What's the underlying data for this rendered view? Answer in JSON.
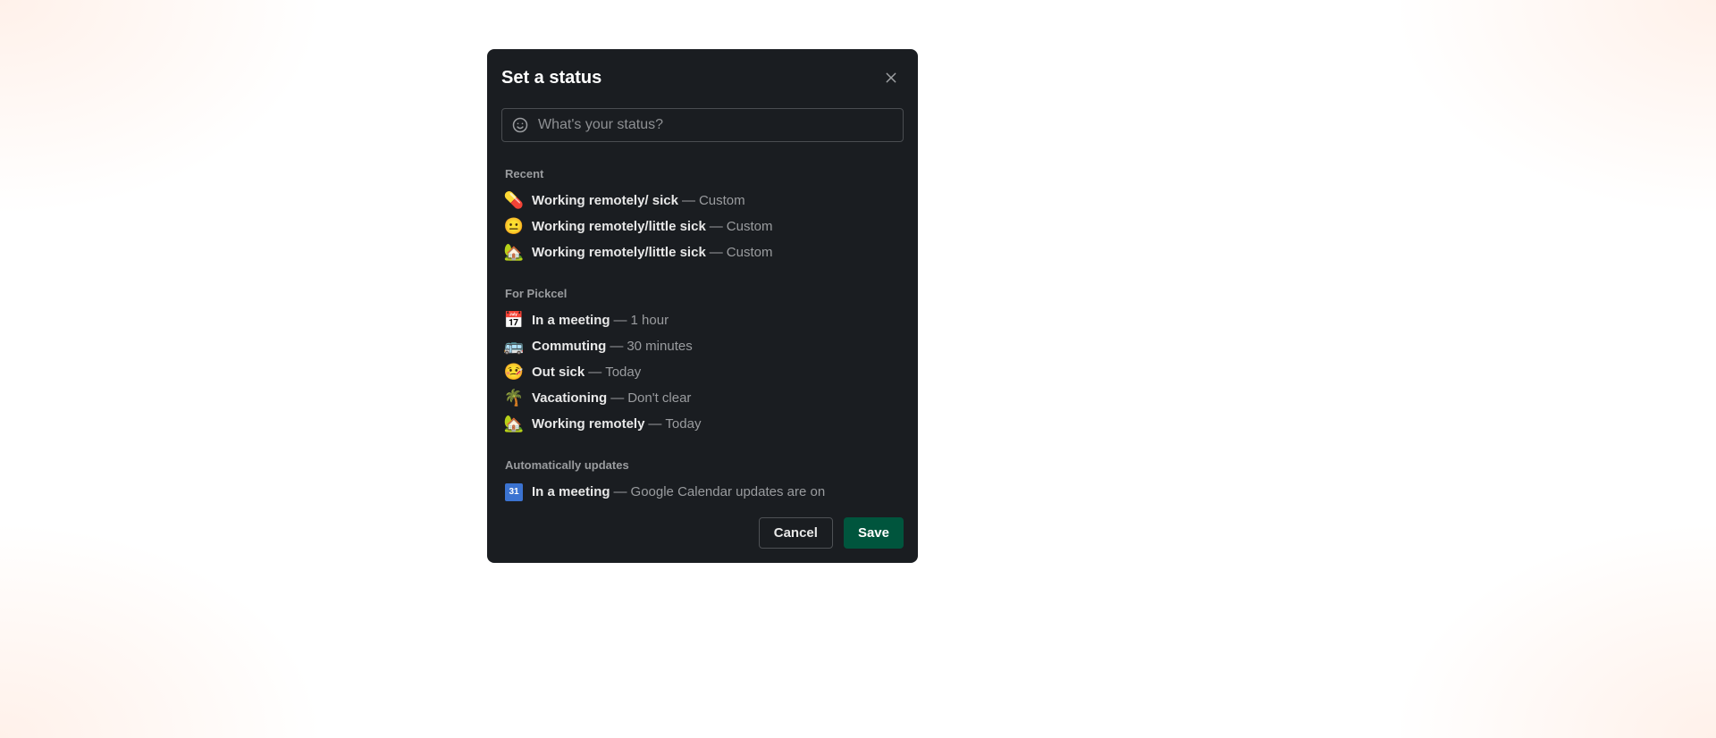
{
  "modal": {
    "title": "Set a status",
    "input_placeholder": "What's your status?",
    "separator": "—",
    "sections": {
      "recent": {
        "heading": "Recent",
        "items": [
          {
            "emoji": "💊",
            "label": "Working remotely/ sick",
            "detail": "Custom"
          },
          {
            "emoji": "😐",
            "label": "Working remotely/little sick",
            "detail": "Custom"
          },
          {
            "emoji": "🏡",
            "label": "Working remotely/little sick",
            "detail": "Custom"
          }
        ]
      },
      "workspace": {
        "heading": "For Pickcel",
        "items": [
          {
            "emoji": "📅",
            "label": "In a meeting",
            "detail": "1 hour"
          },
          {
            "emoji": "🚌",
            "label": "Commuting",
            "detail": "30 minutes"
          },
          {
            "emoji": "🤒",
            "label": "Out sick",
            "detail": "Today"
          },
          {
            "emoji": "🌴",
            "label": "Vacationing",
            "detail": "Don't clear"
          },
          {
            "emoji": "🏡",
            "label": "Working remotely",
            "detail": "Today"
          }
        ]
      },
      "auto": {
        "heading": "Automatically updates",
        "items": [
          {
            "icon_text": "31",
            "label": "In a meeting",
            "detail": "Google Calendar updates are on"
          }
        ]
      }
    },
    "buttons": {
      "cancel": "Cancel",
      "save": "Save"
    }
  }
}
